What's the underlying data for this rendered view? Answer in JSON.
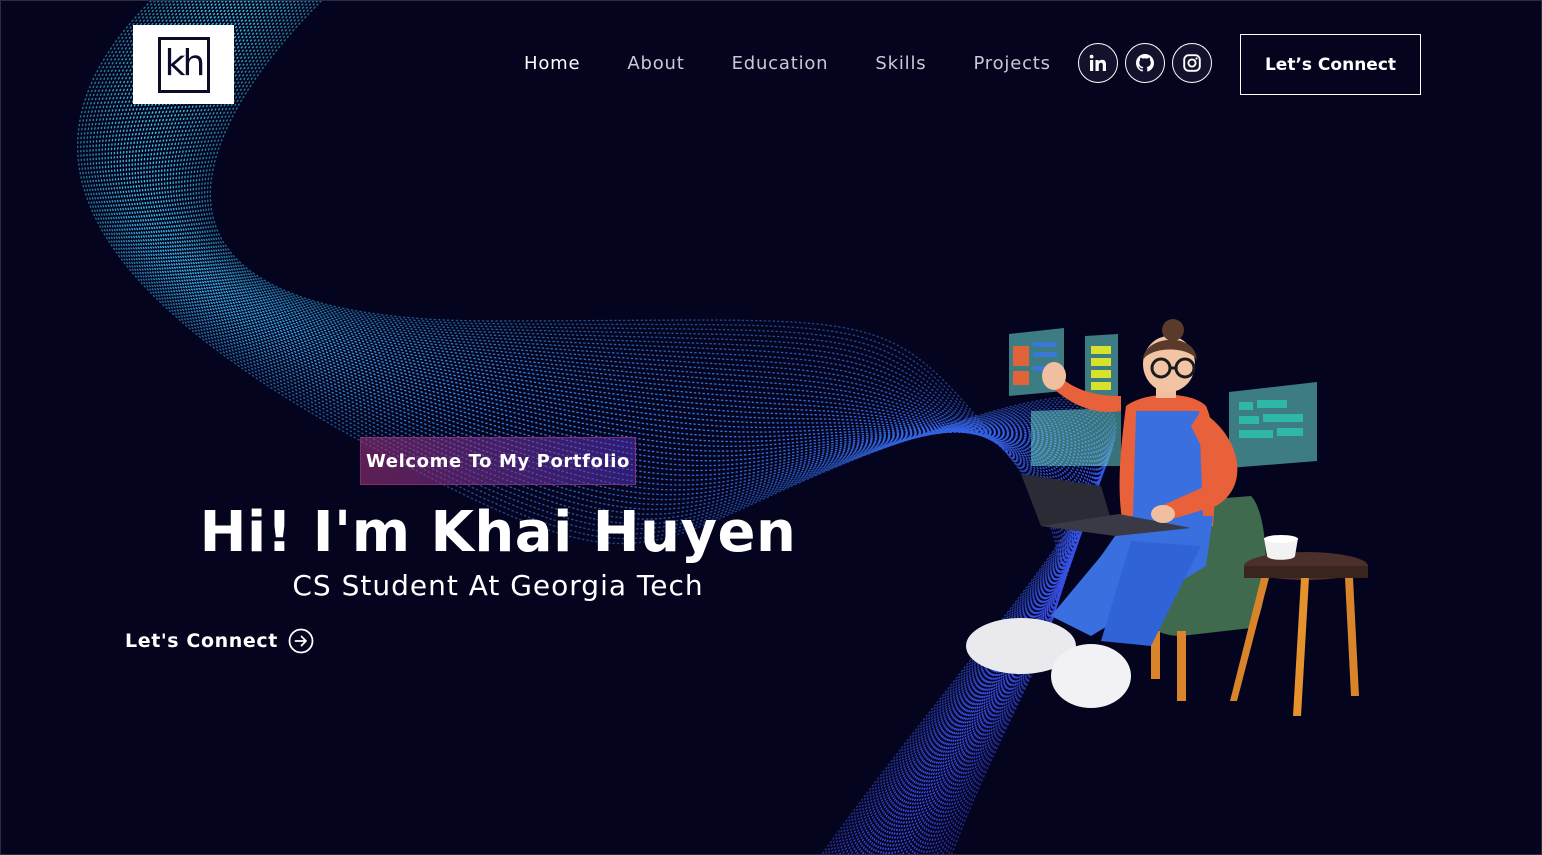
{
  "brand": {
    "logo_text": "kh"
  },
  "nav": {
    "items": [
      {
        "label": "Home",
        "active": true
      },
      {
        "label": "About",
        "active": false
      },
      {
        "label": "Education",
        "active": false
      },
      {
        "label": "Skills",
        "active": false
      },
      {
        "label": "Projects",
        "active": false
      }
    ],
    "socials": [
      {
        "icon": "linkedin-icon"
      },
      {
        "icon": "github-icon"
      },
      {
        "icon": "instagram-icon"
      }
    ],
    "connect_label": "Let’s Connect"
  },
  "hero": {
    "tagline": "Welcome To My Portfolio",
    "title": "Hi! I'm Khai Huyen",
    "subtitle": "CS Student At Georgia Tech",
    "cta_label": "Let's Connect"
  },
  "colors": {
    "background": "#04041f",
    "wave_cyan": "#33c7e6",
    "wave_blue": "#3a4be0",
    "tagline_start": "#aa367c",
    "tagline_end": "#4a2fbd"
  }
}
